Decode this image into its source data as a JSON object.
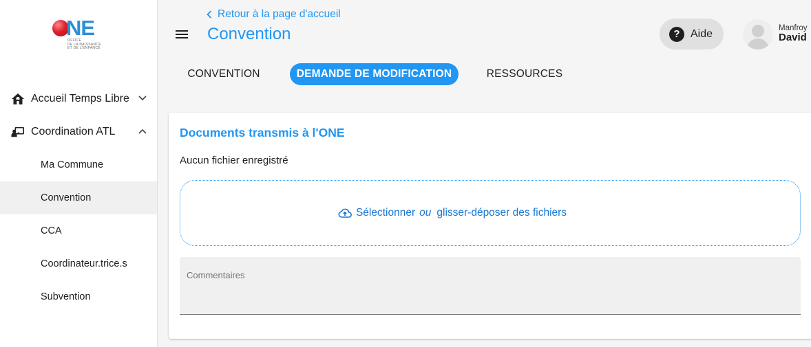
{
  "logo": {
    "word": "NE",
    "tagline": [
      "OFFICE",
      "DE LA NAISSANCE",
      "ET DE L'ENFANCE"
    ]
  },
  "sidebar": {
    "groups": [
      {
        "label": "Accueil Temps Libre",
        "icon": "house-icon",
        "expanded": false
      },
      {
        "label": "Coordination ATL",
        "icon": "person-presenting-icon",
        "expanded": true,
        "items": [
          {
            "label": "Ma Commune",
            "active": false
          },
          {
            "label": "Convention",
            "active": true
          },
          {
            "label": "CCA",
            "active": false
          },
          {
            "label": "Coordinateur.trice.s",
            "active": false
          },
          {
            "label": "Subvention",
            "active": false
          }
        ]
      }
    ]
  },
  "header": {
    "back_link": "Retour à la page d'accueil",
    "title": "Convention",
    "help_label": "Aide",
    "user": {
      "first_name": "Manfroy",
      "last_name": "David"
    }
  },
  "tabs": [
    {
      "label": "CONVENTION",
      "active": false
    },
    {
      "label": "DEMANDE DE MODIFICATION",
      "active": true
    },
    {
      "label": "RESSOURCES",
      "active": false
    }
  ],
  "card": {
    "title": "Documents transmis à l'ONE",
    "status": "Aucun fichier enregistré",
    "dropzone": {
      "select_label": "Sélectionner",
      "or_label": "ou",
      "drop_label": "glisser-déposer des fichiers"
    },
    "comments_label": "Commentaires"
  },
  "colors": {
    "primary": "#2196f3",
    "logo_red": "#e0212e",
    "active_item_bg": "#f0f0f0"
  }
}
